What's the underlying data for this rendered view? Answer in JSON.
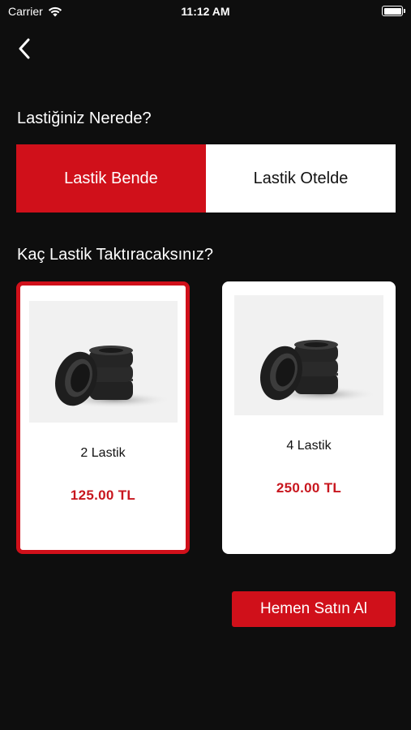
{
  "status_bar": {
    "carrier": "Carrier",
    "time": "11:12 AM",
    "wifi_icon": "wifi-icon",
    "battery_icon": "battery-icon"
  },
  "nav": {
    "back_icon": "chevron-left-icon"
  },
  "location_section": {
    "title": "Lastiğiniz Nerede?",
    "options": [
      {
        "label": "Lastik Bende",
        "selected": true
      },
      {
        "label": "Lastik Otelde",
        "selected": false
      }
    ]
  },
  "count_section": {
    "title": "Kaç Lastik Taktıracaksınız?",
    "cards": [
      {
        "label": "2 Lastik",
        "price": "125.00 TL",
        "selected": true,
        "image": "tires-stack-image"
      },
      {
        "label": "4 Lastik",
        "price": "250.00 TL",
        "selected": false,
        "image": "tires-stack-image"
      }
    ]
  },
  "buy_button": {
    "label": "Hemen Satın Al"
  },
  "colors": {
    "accent": "#d0101a",
    "price": "#c8161e",
    "background": "#0e0e0e"
  }
}
